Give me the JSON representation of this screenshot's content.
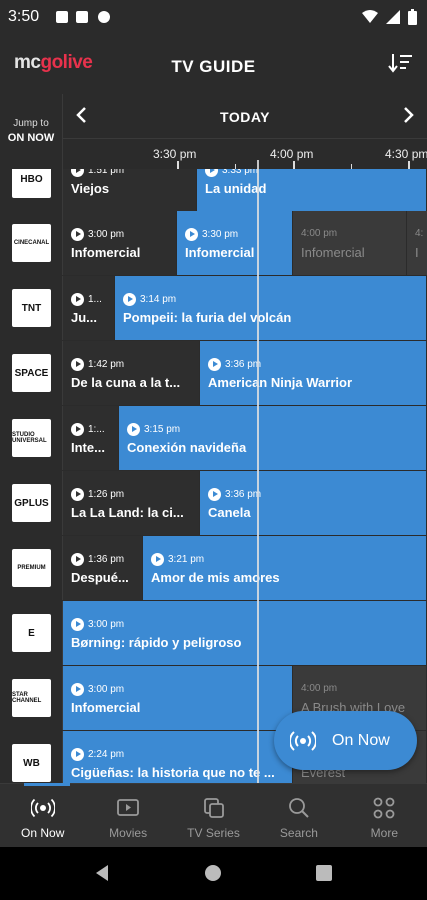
{
  "status_bar": {
    "time": "3:50"
  },
  "header": {
    "logo_part1": "mc",
    "logo_part2": "golive",
    "title": "TV GUIDE"
  },
  "jump": {
    "small": "Jump to",
    "big": "ON NOW"
  },
  "datebar": {
    "date": "TODAY"
  },
  "timebar": {
    "labels": [
      "3:30 pm",
      "4:00 pm",
      "4:30 pm"
    ]
  },
  "channels": [
    {
      "logo": "HBO",
      "programs": [
        {
          "time": "1:51 pm",
          "title": "Viejos",
          "style": "dark"
        },
        {
          "time": "3:33 pm",
          "title": "La unidad",
          "style": "blue"
        }
      ]
    },
    {
      "logo": "CINECANAL",
      "programs": [
        {
          "time": "3:00 pm",
          "title": "Infomercial",
          "style": "dark"
        },
        {
          "time": "3:30 pm",
          "title": "Infomercial",
          "style": "blue"
        },
        {
          "time": "4:00 pm",
          "title": "Infomercial",
          "style": "gray"
        },
        {
          "time": "4:",
          "title": "I",
          "style": "gray"
        }
      ]
    },
    {
      "logo": "TNT",
      "programs": [
        {
          "time": "1...",
          "title": "Ju...",
          "style": "dark"
        },
        {
          "time": "3:14 pm",
          "title": "Pompeii: la furia del volcán",
          "style": "blue"
        }
      ]
    },
    {
      "logo": "SPACE",
      "programs": [
        {
          "time": "1:42 pm",
          "title": "De la cuna a la t...",
          "style": "dark"
        },
        {
          "time": "3:36 pm",
          "title": "American Ninja Warrior",
          "style": "blue"
        }
      ]
    },
    {
      "logo": "STUDIO UNIVERSAL",
      "programs": [
        {
          "time": "1:...",
          "title": "Inte...",
          "style": "dark"
        },
        {
          "time": "3:15 pm",
          "title": "Conexión navideña",
          "style": "blue"
        }
      ]
    },
    {
      "logo": "GPLUS",
      "programs": [
        {
          "time": "1:26 pm",
          "title": "La La Land: la ci...",
          "style": "dark"
        },
        {
          "time": "3:36 pm",
          "title": "Canela",
          "style": "blue"
        }
      ]
    },
    {
      "logo": "PREMIUM",
      "programs": [
        {
          "time": "1:36 pm",
          "title": "Despué...",
          "style": "dark"
        },
        {
          "time": "3:21 pm",
          "title": "Amor de mis amores",
          "style": "blue"
        }
      ]
    },
    {
      "logo": "E",
      "programs": [
        {
          "time": "3:00 pm",
          "title": "Børning: rápido y peligroso",
          "style": "blue"
        }
      ]
    },
    {
      "logo": "STAR CHANNEL",
      "programs": [
        {
          "time": "3:00 pm",
          "title": "Infomercial",
          "style": "blue"
        },
        {
          "time": "4:00 pm",
          "title": "A Brush with Love",
          "style": "gray"
        }
      ]
    },
    {
      "logo": "WB",
      "programs": [
        {
          "time": "2:24 pm",
          "title": "Cigüeñas: la historia que no te ...",
          "style": "blue"
        },
        {
          "time": "",
          "title": "Everest",
          "style": "gray"
        }
      ]
    }
  ],
  "fab": {
    "label": "On Now"
  },
  "bottom_nav": [
    {
      "label": "On Now",
      "icon": "broadcast-icon",
      "active": true
    },
    {
      "label": "Movies",
      "icon": "movie-icon",
      "active": false
    },
    {
      "label": "TV Series",
      "icon": "tv-series-icon",
      "active": false
    },
    {
      "label": "Search",
      "icon": "search-icon",
      "active": false
    },
    {
      "label": "More",
      "icon": "more-icon",
      "active": false
    }
  ],
  "colors": {
    "accent": "#3c8ad3",
    "brand": "#e8324c",
    "background": "#2b2b2b"
  }
}
